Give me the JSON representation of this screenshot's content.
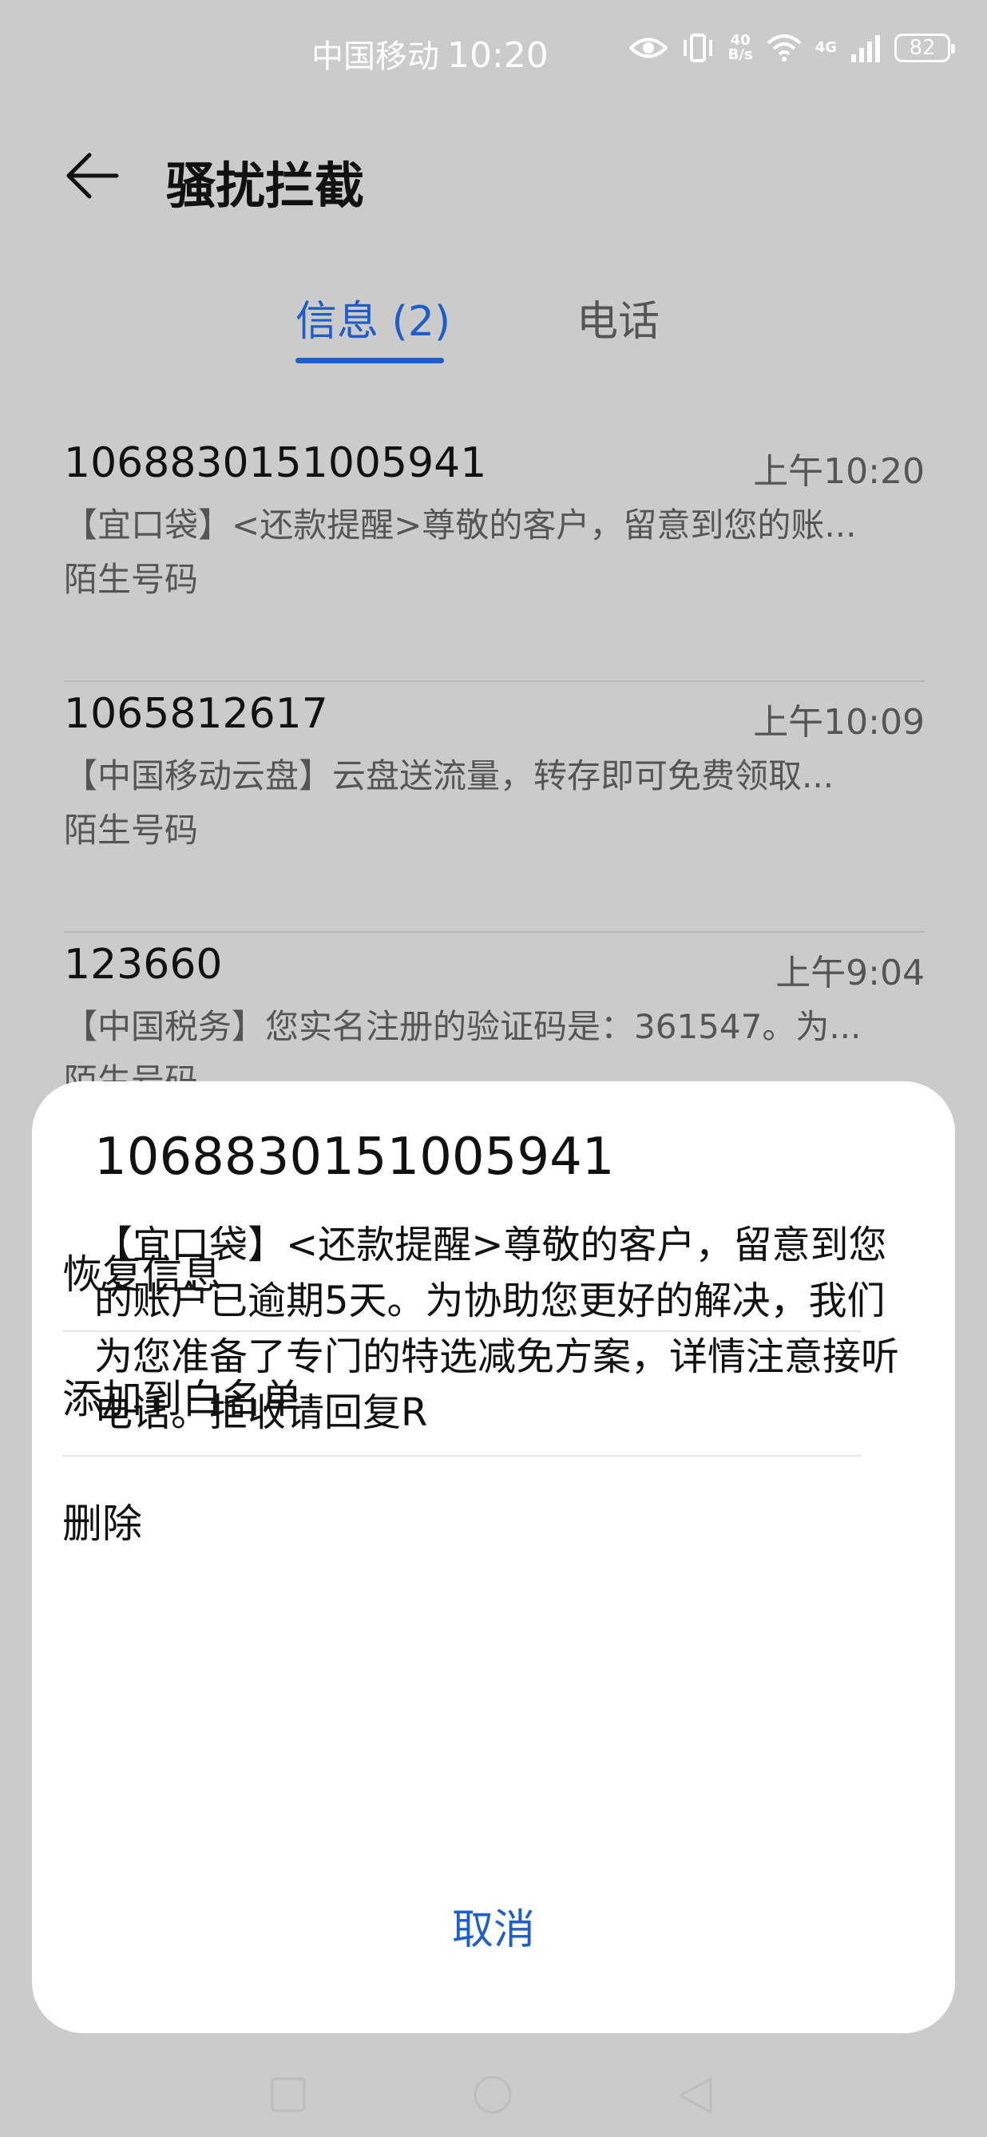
{
  "status": {
    "carrier": "中国移动",
    "time": "10:20",
    "net_speed_value": "40",
    "net_speed_unit": "B/s",
    "network": "4G",
    "battery": "82"
  },
  "header": {
    "title": "骚扰拦截"
  },
  "tabs": [
    {
      "label": "信息 (2)",
      "selected": true
    },
    {
      "label": "电话",
      "selected": false
    }
  ],
  "messages": [
    {
      "sender": "1068830151005941",
      "time": "上午10:20",
      "preview": "【宜口袋】<还款提醒>尊敬的客户，留意到您的账...",
      "tag": "陌生号码"
    },
    {
      "sender": "1065812617",
      "time": "上午10:09",
      "preview": "【中国移动云盘】云盘送流量，转存即可免费领取...",
      "tag": "陌生号码"
    },
    {
      "sender": "123660",
      "time": "上午9:04",
      "preview": "【中国税务】您实名注册的验证码是：361547。为...",
      "tag": "陌生号码"
    }
  ],
  "sheet": {
    "title": "1068830151005941",
    "body": "【宜口袋】<还款提醒>尊敬的客户，留意到您的账户已逾期5天。为协助您更好的解决，我们为您准备了专门的特选减免方案，详情注意接听电话。拒收请回复R",
    "actions": [
      "恢复信息",
      "添加到白名单",
      "删除"
    ],
    "cancel": "取消"
  },
  "colors": {
    "accent": "#1f5ec7",
    "overlay_background": "#cbcbcb",
    "sheet_background": "#ffffff"
  },
  "icons": [
    "back-arrow-icon",
    "eye-icon",
    "vibrate-icon",
    "wifi-icon",
    "signal-icon",
    "battery-icon",
    "nav-square-icon",
    "nav-circle-icon",
    "nav-triangle-icon"
  ]
}
